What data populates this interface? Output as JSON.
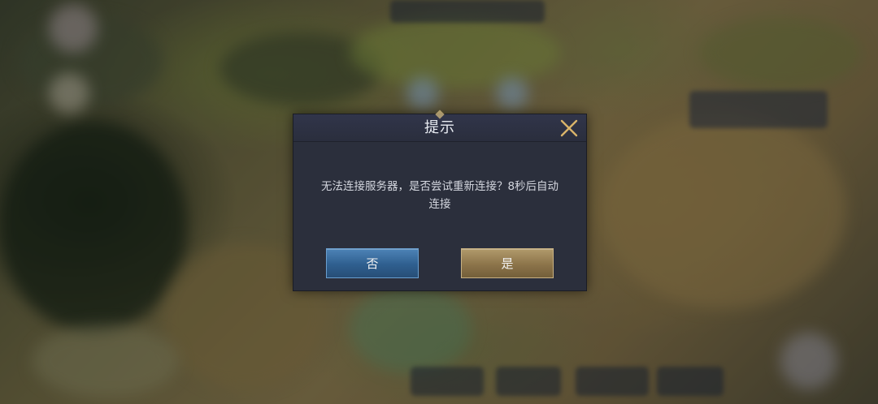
{
  "dialog": {
    "title": "提示",
    "message_line1": "无法连接服务器，是否尝试重新连接？8秒后自动",
    "message_line2": "连接",
    "no_label": "否",
    "yes_label": "是"
  },
  "icons": {
    "close": "close-icon"
  },
  "colors": {
    "dialog_bg": "#2b2f3c",
    "close_icon": "#d9b46a",
    "no_button": "#3a6d9e",
    "yes_button": "#8f7850"
  }
}
